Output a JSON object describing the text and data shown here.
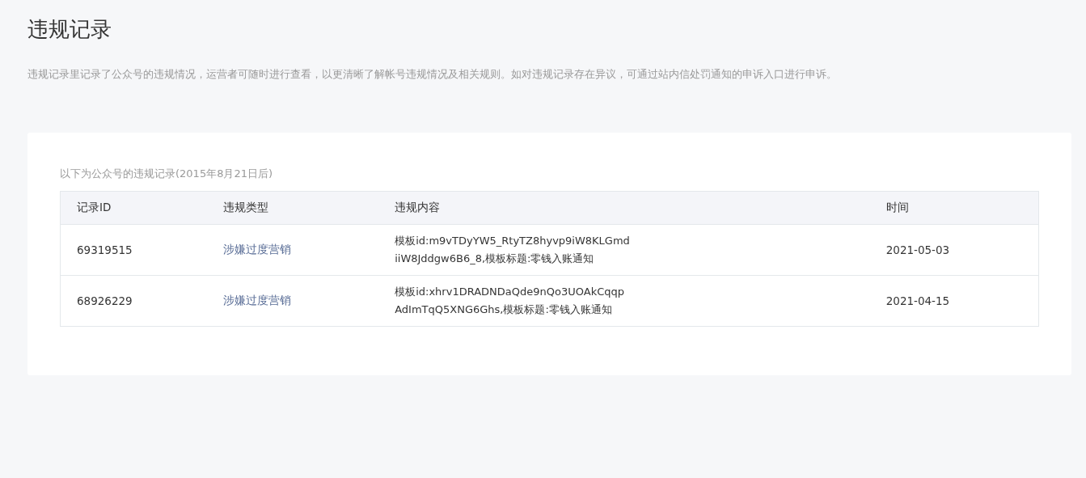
{
  "page": {
    "title": "违规记录",
    "description": "违规记录里记录了公众号的违规情况，运营者可随时进行查看，以更清晰了解帐号违规情况及相关规则。如对违规记录存在异议，可通过站内信处罚通知的申诉入口进行申诉。"
  },
  "records": {
    "caption": "以下为公众号的违规记录(2015年8月21日后)",
    "columns": [
      "记录ID",
      "违规类型",
      "违规内容",
      "时间"
    ],
    "rows": [
      {
        "id": "69319515",
        "type": "涉嫌过度营销",
        "content_lines": [
          "模板id:m9vTDyYW5_RtyTZ8hyvp9iW8KLGmd",
          "iiW8Jddgw6B6_8,模板标题:零钱入账通知"
        ],
        "time": "2021-05-03"
      },
      {
        "id": "68926229",
        "type": "涉嫌过度营销",
        "content_lines": [
          "模板id:xhrv1DRADNDaQde9nQo3UOAkCqqp",
          "AdImTqQ5XNG6Ghs,模板标题:零钱入账通知"
        ],
        "time": "2021-04-15"
      }
    ]
  }
}
